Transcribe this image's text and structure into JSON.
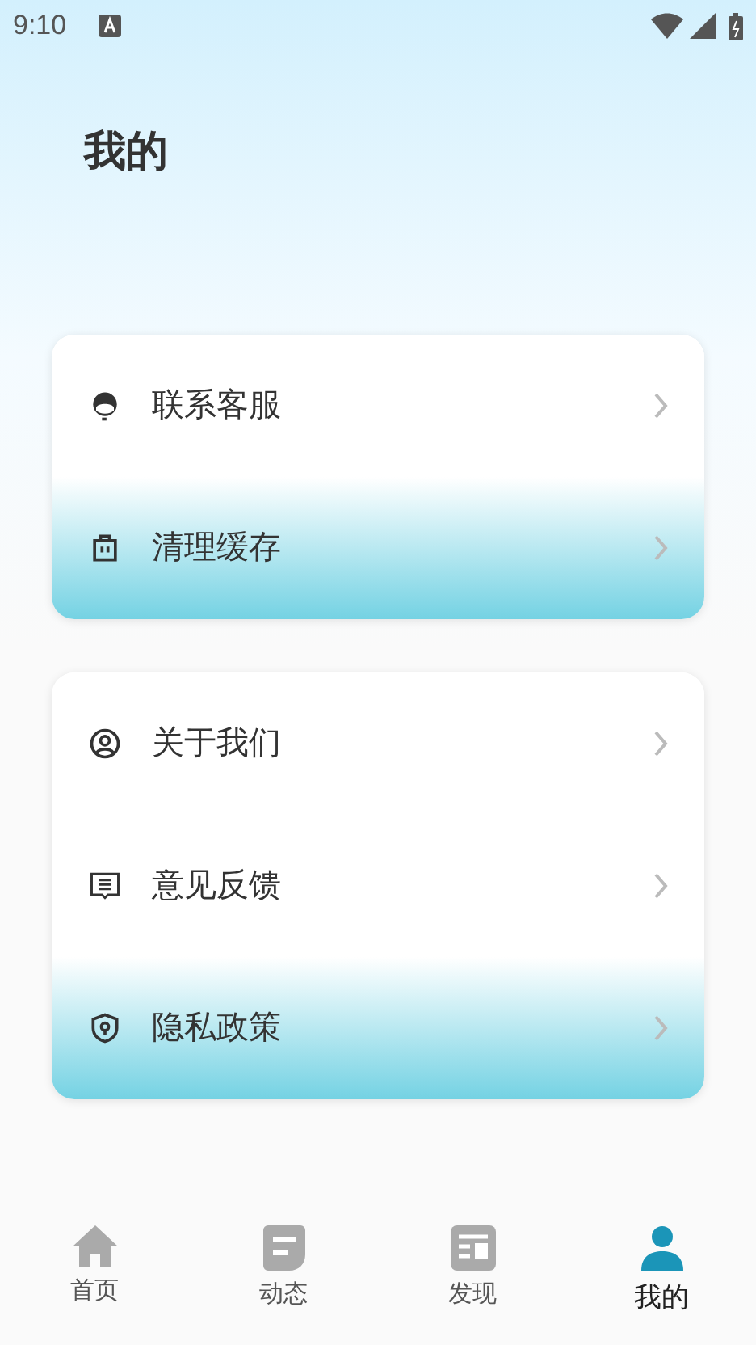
{
  "status_bar": {
    "time": "9:10"
  },
  "title": "我的",
  "groups": [
    {
      "items": [
        {
          "label": "联系客服",
          "highlighted": false
        },
        {
          "label": "清理缓存",
          "highlighted": true
        }
      ]
    },
    {
      "items": [
        {
          "label": "关于我们",
          "highlighted": false
        },
        {
          "label": "意见反馈",
          "highlighted": false
        },
        {
          "label": "隐私政策",
          "highlighted": true
        }
      ]
    }
  ],
  "tabs": [
    {
      "label": "首页",
      "selected": false
    },
    {
      "label": "动态",
      "selected": false
    },
    {
      "label": "发现",
      "selected": false
    },
    {
      "label": "我的",
      "selected": true
    }
  ]
}
